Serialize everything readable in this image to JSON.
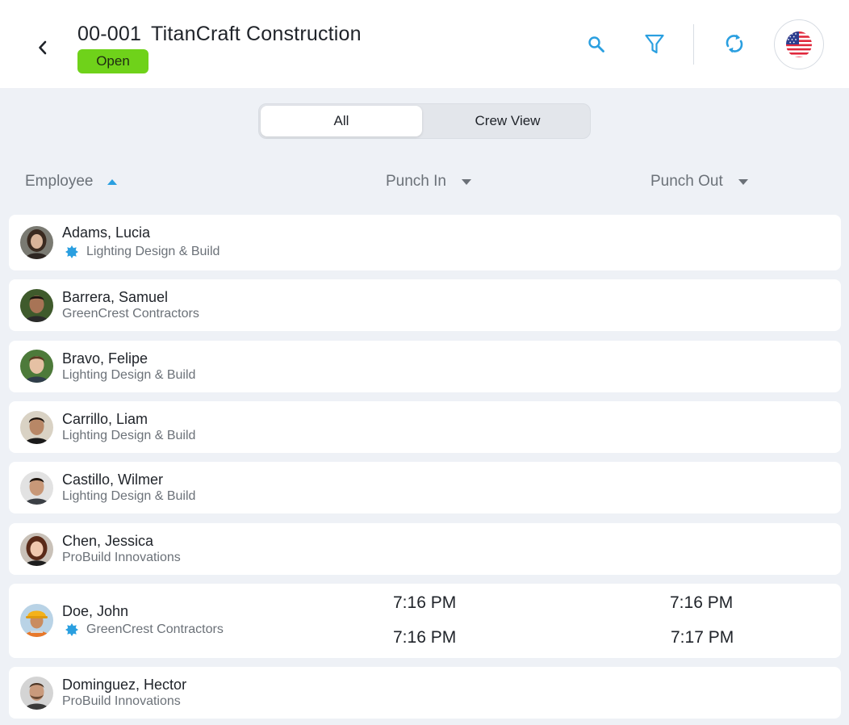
{
  "header": {
    "job_code": "00-001",
    "job_name": "TitanCraft Construction",
    "status": "Open"
  },
  "icons": {
    "back": "chevron-left-icon",
    "search": "search-icon",
    "filter": "filter-icon",
    "refresh": "refresh-icon",
    "language": "us-flag-icon",
    "crew_lead": "crew-lead-badge-icon",
    "sort_asc": "sort-asc-icon",
    "sort_desc": "sort-desc-icon"
  },
  "colors": {
    "accent": "#2a9fe0",
    "status_open": "#6fd21a",
    "background": "#eef1f6"
  },
  "view_toggle": {
    "options": [
      "All",
      "Crew View"
    ],
    "selected": "All"
  },
  "columns": {
    "employee": "Employee",
    "punch_in": "Punch In",
    "punch_out": "Punch Out"
  },
  "employees": [
    {
      "name": "Adams, Lucia",
      "company": "Lighting Design & Build",
      "crew_lead": true,
      "punches": []
    },
    {
      "name": "Barrera, Samuel",
      "company": "GreenCrest Contractors",
      "crew_lead": false,
      "punches": []
    },
    {
      "name": "Bravo, Felipe",
      "company": "Lighting Design & Build",
      "crew_lead": false,
      "punches": []
    },
    {
      "name": "Carrillo, Liam",
      "company": "Lighting Design & Build",
      "crew_lead": false,
      "punches": []
    },
    {
      "name": "Castillo, Wilmer",
      "company": "Lighting Design & Build",
      "crew_lead": false,
      "punches": []
    },
    {
      "name": "Chen, Jessica",
      "company": "ProBuild Innovations",
      "crew_lead": false,
      "punches": []
    },
    {
      "name": "Doe, John",
      "company": "GreenCrest Contractors",
      "crew_lead": true,
      "punches": [
        {
          "in": "7:16 PM",
          "out": "7:16 PM"
        },
        {
          "in": "7:16 PM",
          "out": "7:17 PM"
        }
      ]
    },
    {
      "name": "Dominguez, Hector",
      "company": "ProBuild Innovations",
      "crew_lead": false,
      "punches": []
    }
  ]
}
